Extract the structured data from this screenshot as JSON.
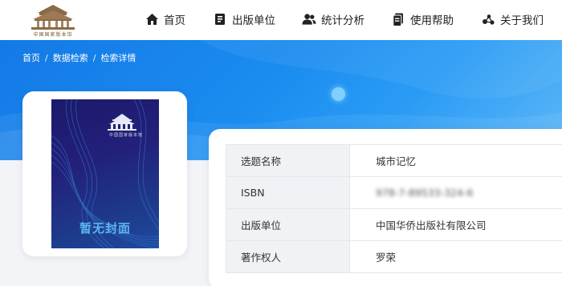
{
  "header": {
    "logo_text": "中国国家版本馆",
    "nav": [
      {
        "label": "首页",
        "icon": "home-icon"
      },
      {
        "label": "出版单位",
        "icon": "book-icon"
      },
      {
        "label": "统计分析",
        "icon": "users-icon"
      },
      {
        "label": "使用帮助",
        "icon": "document-icon"
      },
      {
        "label": "关于我们",
        "icon": "share-icon"
      }
    ]
  },
  "breadcrumb": [
    "首页",
    "数据检索",
    "检索详情"
  ],
  "breadcrumb_separator": "/",
  "cover": {
    "title": "暂无封面",
    "logo_text": "中国国家版本馆"
  },
  "details": [
    {
      "label": "选题名称",
      "value": "城市记忆"
    },
    {
      "label": "ISBN",
      "value": "978-7-89533-324-6"
    },
    {
      "label": "出版单位",
      "value": "中国华侨出版社有限公司"
    },
    {
      "label": "著作权人",
      "value": "罗荣"
    }
  ],
  "colors": {
    "banner_primary": "#1479e6",
    "banner_light": "#5fb8f7",
    "cover_title": "#5ab4f0"
  }
}
